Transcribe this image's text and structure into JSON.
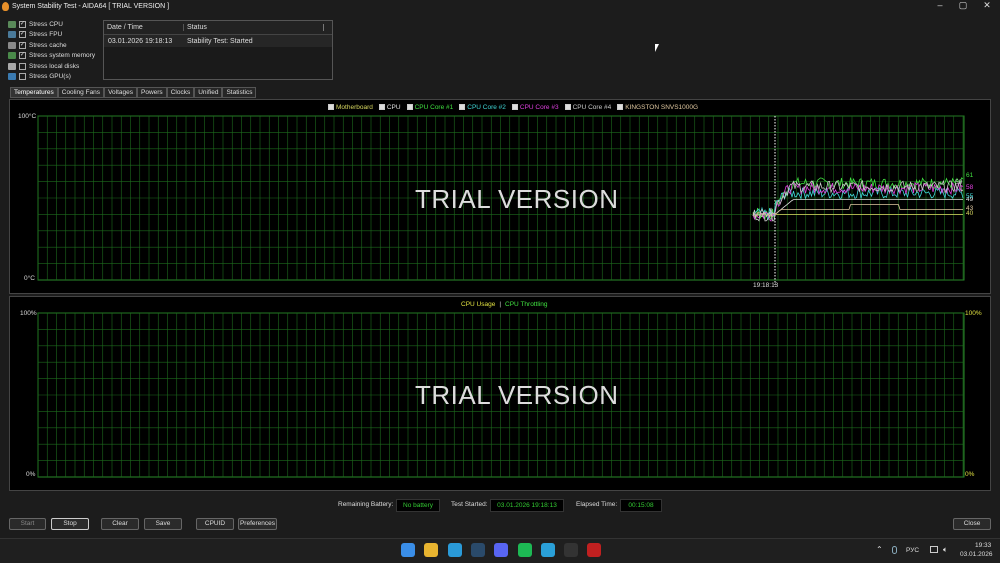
{
  "window": {
    "title": "System Stability Test - AIDA64  [ TRIAL VERSION ]"
  },
  "stress_options": [
    {
      "label": "Stress CPU",
      "checked": true
    },
    {
      "label": "Stress FPU",
      "checked": true
    },
    {
      "label": "Stress cache",
      "checked": true
    },
    {
      "label": "Stress system memory",
      "checked": true
    },
    {
      "label": "Stress local disks",
      "checked": false
    },
    {
      "label": "Stress GPU(s)",
      "checked": false
    }
  ],
  "log": {
    "headers": [
      "Date / Time",
      "Status"
    ],
    "rows": [
      [
        "03.01.2026 19:18:13",
        "Stability Test: Started"
      ]
    ]
  },
  "tabs": [
    "Temperatures",
    "Cooling Fans",
    "Voltages",
    "Powers",
    "Clocks",
    "Unified",
    "Statistics"
  ],
  "active_tab": "Temperatures",
  "watermark": "TRIAL VERSION",
  "chart_data": [
    {
      "type": "line",
      "ylim": [
        0,
        100
      ],
      "y_top_label": "100°C",
      "y_bottom_label": "0°C",
      "grid": true,
      "x_marker_label": "19:18:13",
      "series": [
        {
          "name": "Motherboard",
          "color": "#d8d860",
          "current": 40
        },
        {
          "name": "CPU",
          "color": "#e0e0e0",
          "current": 49
        },
        {
          "name": "CPU Core #1",
          "color": "#40e040",
          "current": 61
        },
        {
          "name": "CPU Core #2",
          "color": "#40d8d8",
          "current": 55
        },
        {
          "name": "CPU Core #3",
          "color": "#e040e0",
          "current": 58
        },
        {
          "name": "CPU Core #4",
          "color": "#c8c8c8",
          "current": 59
        },
        {
          "name": "KINGSTON SNVS1000G",
          "color": "#e0c8a0",
          "current": 43
        }
      ]
    },
    {
      "type": "line",
      "ylim": [
        0,
        100
      ],
      "y_top_label": "100%",
      "y_bottom_label": "0%",
      "right_top_label": "100%",
      "right_bottom_label": "0%",
      "grid": true,
      "series": [
        {
          "name": "CPU Usage",
          "color": "#e0e040"
        },
        {
          "name": "CPU Throttling",
          "color": "#40e040"
        }
      ],
      "separator": "|"
    }
  ],
  "status": {
    "battery_label": "Remaining Battery:",
    "battery_value": "No battery",
    "started_label": "Test Started:",
    "started_value": "03.01.2026 19:18:13",
    "elapsed_label": "Elapsed Time:",
    "elapsed_value": "00:15:08"
  },
  "buttons": {
    "start": "Start",
    "stop": "Stop",
    "clear": "Clear",
    "save": "Save",
    "cpuid": "CPUID",
    "preferences": "Preferences",
    "close": "Close"
  },
  "tray": {
    "lang": "РУС",
    "time": "19:33",
    "date": "03.01.2026"
  },
  "taskbar_apps": [
    "windows-start",
    "file-explorer",
    "edge",
    "steam",
    "discord",
    "spotify",
    "telegram",
    "epic-games",
    "aida64"
  ]
}
